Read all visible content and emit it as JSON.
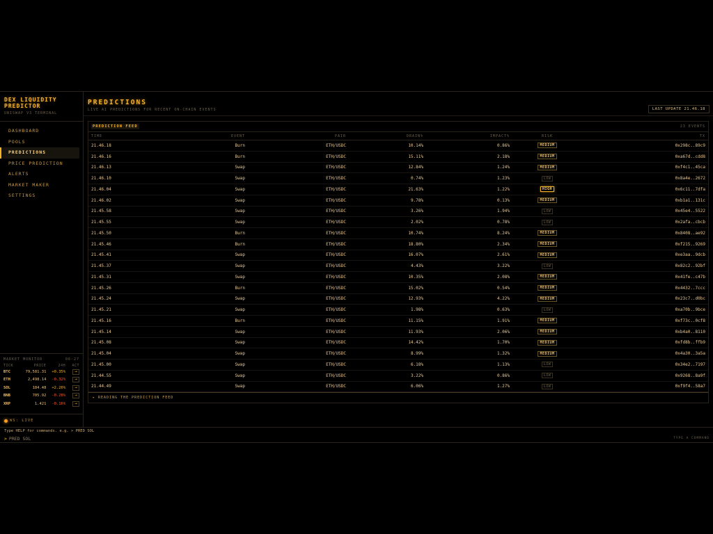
{
  "brand": {
    "title": "DEX LIQUIDITY PREDICTOR",
    "subtitle": "UNISWAP V3 TERMINAL"
  },
  "nav": [
    {
      "label": "DASHBOARD",
      "active": false
    },
    {
      "label": "POOLS",
      "active": false
    },
    {
      "label": "PREDICTIONS",
      "active": true
    },
    {
      "label": "PRICE PREDICTION",
      "active": false
    },
    {
      "label": "ALERTS",
      "active": false
    },
    {
      "label": "MARKET MAKER",
      "active": false
    },
    {
      "label": "SETTINGS",
      "active": false
    }
  ],
  "monitor": {
    "title": "MARKET MONITOR",
    "count": "06-27",
    "columns": [
      "TICK",
      "PRICE",
      "24H",
      "ACT"
    ],
    "rows": [
      {
        "tick": "BTC",
        "price": "79,581.31",
        "change": "+0.35%",
        "dir": "pos",
        "action": "→"
      },
      {
        "tick": "ETH",
        "price": "2,498.14",
        "change": "-0.32%",
        "dir": "neg",
        "action": "→"
      },
      {
        "tick": "SOL",
        "price": "184.48",
        "change": "+2.26%",
        "dir": "pos",
        "action": "→"
      },
      {
        "tick": "BNB",
        "price": "705.92",
        "change": "-0.28%",
        "dir": "neg",
        "action": "→"
      },
      {
        "tick": "XRP",
        "price": "1.421",
        "change": "-0.16%",
        "dir": "neg",
        "action": "→"
      }
    ]
  },
  "ws_status": "WS: LIVE",
  "header": {
    "title": "PREDICTIONS",
    "subtitle": "LIVE AI PREDICTIONS FOR RECENT ON-CHAIN EVENTS",
    "last_update": "LAST UPDATE 21.46.18"
  },
  "feed": {
    "title": "PREDICTION FEED",
    "count": "23 EVENTS",
    "columns": [
      "TIME",
      "EVENT",
      "PAIR",
      "DRAIN%",
      "IMPACT%",
      "RISK",
      "TX"
    ],
    "rows": [
      {
        "time": "21.46.18",
        "event": "Burn",
        "pair": "ETH/USDC",
        "drain": "10.14%",
        "impact": "0.86%",
        "risk": "MEDIUM",
        "tx": "0x298c..89c9"
      },
      {
        "time": "21.46.16",
        "event": "Burn",
        "pair": "ETH/USDC",
        "drain": "15.11%",
        "impact": "2.18%",
        "risk": "MEDIUM",
        "tx": "0xa67d..cdd8"
      },
      {
        "time": "21.46.13",
        "event": "Swap",
        "pair": "ETH/USDC",
        "drain": "12.84%",
        "impact": "1.24%",
        "risk": "MEDIUM",
        "tx": "0xf4c1..45ca"
      },
      {
        "time": "21.46.10",
        "event": "Swap",
        "pair": "ETH/USDC",
        "drain": "0.74%",
        "impact": "1.23%",
        "risk": "LOW",
        "tx": "0x8a4e..2672"
      },
      {
        "time": "21.46.04",
        "event": "Swap",
        "pair": "ETH/USDC",
        "drain": "21.63%",
        "impact": "1.22%",
        "risk": "HIGH",
        "tx": "0x6c11..7dfa"
      },
      {
        "time": "21.46.02",
        "event": "Swap",
        "pair": "ETH/USDC",
        "drain": "9.78%",
        "impact": "0.13%",
        "risk": "MEDIUM",
        "tx": "0xb1a1..131c"
      },
      {
        "time": "21.45.58",
        "event": "Swap",
        "pair": "ETH/USDC",
        "drain": "3.26%",
        "impact": "1.94%",
        "risk": "LOW",
        "tx": "0x45e4..5522"
      },
      {
        "time": "21.45.55",
        "event": "Swap",
        "pair": "ETH/USDC",
        "drain": "2.02%",
        "impact": "0.78%",
        "risk": "LOW",
        "tx": "0x2afa..cbcb"
      },
      {
        "time": "21.45.50",
        "event": "Burn",
        "pair": "ETH/USDC",
        "drain": "10.74%",
        "impact": "8.24%",
        "risk": "MEDIUM",
        "tx": "0x8408..ae92"
      },
      {
        "time": "21.45.46",
        "event": "Burn",
        "pair": "ETH/USDC",
        "drain": "18.80%",
        "impact": "2.34%",
        "risk": "MEDIUM",
        "tx": "0xf215..9269"
      },
      {
        "time": "21.45.41",
        "event": "Swap",
        "pair": "ETH/USDC",
        "drain": "16.07%",
        "impact": "2.61%",
        "risk": "MEDIUM",
        "tx": "0xe3aa..9dcb"
      },
      {
        "time": "21.45.37",
        "event": "Swap",
        "pair": "ETH/USDC",
        "drain": "4.43%",
        "impact": "3.22%",
        "risk": "LOW",
        "tx": "0x82c2..92bf"
      },
      {
        "time": "21.45.31",
        "event": "Swap",
        "pair": "ETH/USDC",
        "drain": "10.35%",
        "impact": "2.08%",
        "risk": "MEDIUM",
        "tx": "0x41fe..c47b"
      },
      {
        "time": "21.45.26",
        "event": "Burn",
        "pair": "ETH/USDC",
        "drain": "15.02%",
        "impact": "0.54%",
        "risk": "MEDIUM",
        "tx": "0x4432..7ccc"
      },
      {
        "time": "21.45.24",
        "event": "Swap",
        "pair": "ETH/USDC",
        "drain": "12.93%",
        "impact": "4.22%",
        "risk": "MEDIUM",
        "tx": "0x23c7..d0bc"
      },
      {
        "time": "21.45.21",
        "event": "Swap",
        "pair": "ETH/USDC",
        "drain": "1.98%",
        "impact": "0.63%",
        "risk": "LOW",
        "tx": "0xa70b..9bce"
      },
      {
        "time": "21.45.16",
        "event": "Burn",
        "pair": "ETH/USDC",
        "drain": "11.15%",
        "impact": "1.91%",
        "risk": "MEDIUM",
        "tx": "0xf73c..0cf8"
      },
      {
        "time": "21.45.14",
        "event": "Swap",
        "pair": "ETH/USDC",
        "drain": "11.93%",
        "impact": "2.06%",
        "risk": "MEDIUM",
        "tx": "0xb4a0..8110"
      },
      {
        "time": "21.45.08",
        "event": "Swap",
        "pair": "ETH/USDC",
        "drain": "14.42%",
        "impact": "1.70%",
        "risk": "MEDIUM",
        "tx": "0xfd8b..ffb9"
      },
      {
        "time": "21.45.04",
        "event": "Swap",
        "pair": "ETH/USDC",
        "drain": "8.99%",
        "impact": "1.32%",
        "risk": "MEDIUM",
        "tx": "0x4a30..3a5a"
      },
      {
        "time": "21.45.00",
        "event": "Swap",
        "pair": "ETH/USDC",
        "drain": "6.18%",
        "impact": "1.13%",
        "risk": "LOW",
        "tx": "0x34e2..7197"
      },
      {
        "time": "21.44.55",
        "event": "Swap",
        "pair": "ETH/USDC",
        "drain": "3.22%",
        "impact": "0.86%",
        "risk": "LOW",
        "tx": "0x9268..8a9f"
      },
      {
        "time": "21.44.49",
        "event": "Swap",
        "pair": "ETH/USDC",
        "drain": "6.06%",
        "impact": "1.27%",
        "risk": "LOW",
        "tx": "0xf9f4..58a7"
      }
    ],
    "footer": "▸ READING THE PREDICTION FEED"
  },
  "command": {
    "help": "Type HELP for commands. e.g. > PRED SOL",
    "prompt": ">",
    "input": "PRED SOL",
    "hint": "TYPE A COMMAND"
  },
  "colors": {
    "accent": "#f5b32a",
    "negative": "#ff5a2a",
    "background": "#000000"
  }
}
